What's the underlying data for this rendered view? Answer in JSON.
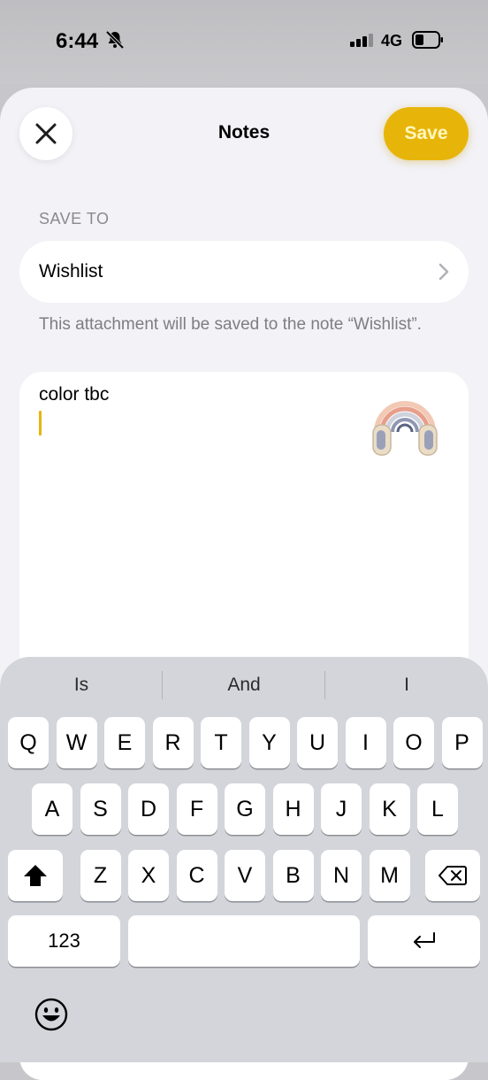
{
  "status_bar": {
    "time": "6:44",
    "network": "4G"
  },
  "header": {
    "title": "Notes",
    "save_label": "Save"
  },
  "save_to": {
    "label": "SAVE TO",
    "folder": "Wishlist",
    "helper": "This attachment will be saved to the note “Wishlist”."
  },
  "note": {
    "text": "color tbc",
    "attachment_icon": "headphones-image"
  },
  "keyboard": {
    "suggestions": [
      "Is",
      "And",
      "I"
    ],
    "row1": [
      "Q",
      "W",
      "E",
      "R",
      "T",
      "Y",
      "U",
      "I",
      "O",
      "P"
    ],
    "row2": [
      "A",
      "S",
      "D",
      "F",
      "G",
      "H",
      "J",
      "K",
      "L"
    ],
    "row3": [
      "Z",
      "X",
      "C",
      "V",
      "B",
      "N",
      "M"
    ],
    "numbers_label": "123"
  },
  "colors": {
    "accent": "#e7b50a",
    "sheet": "#f2f2f7",
    "keyboard": "#d4d5db"
  }
}
